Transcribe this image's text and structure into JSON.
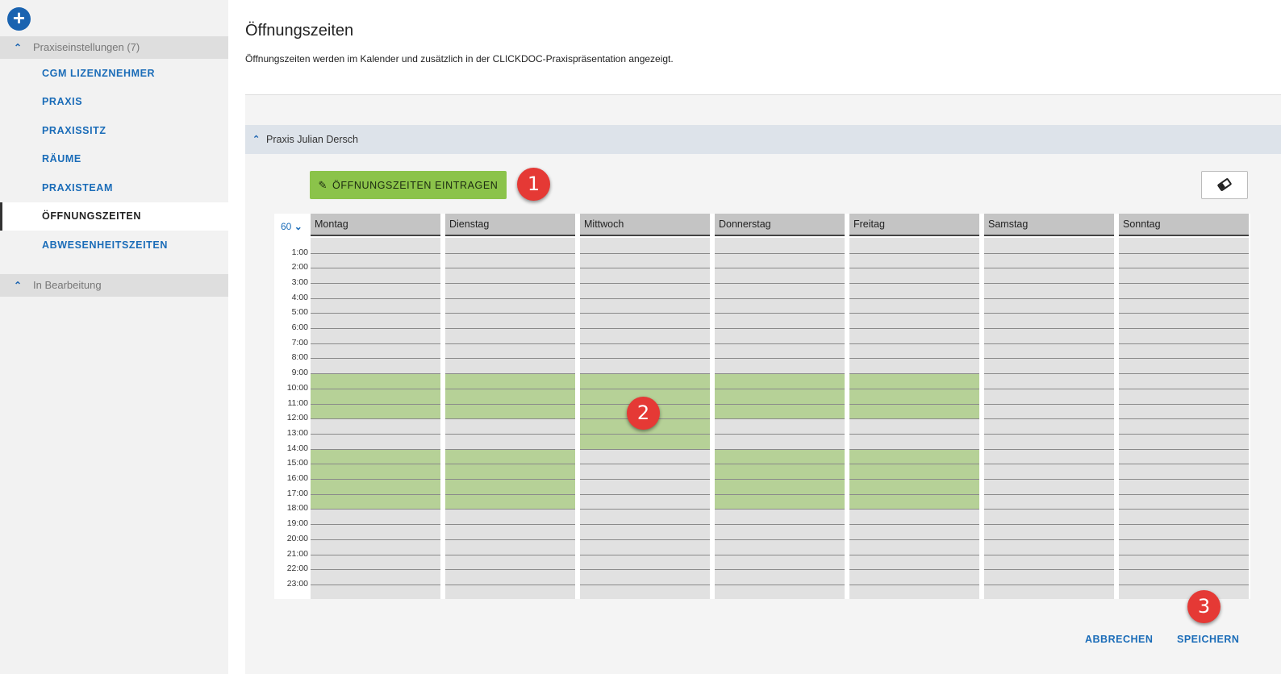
{
  "sidebar": {
    "add_icon": "plus-icon",
    "group_settings": "Praxiseinstellungen (7)",
    "items": [
      {
        "label": "CGM LIZENZNEHMER",
        "active": false
      },
      {
        "label": "PRAXIS",
        "active": false
      },
      {
        "label": "PRAXISSITZ",
        "active": false
      },
      {
        "label": "RÄUME",
        "active": false
      },
      {
        "label": "PRAXISTEAM",
        "active": false
      },
      {
        "label": "ÖFFNUNGSZEITEN",
        "active": true
      },
      {
        "label": "ABWESENHEITSZEITEN",
        "active": false
      }
    ],
    "group_editing": "In Bearbeitung"
  },
  "page": {
    "title": "Öffnungszeiten",
    "description": "Öffnungszeiten werden im Kalender und zusätzlich in der CLICKDOC-Praxispräsentation angezeigt."
  },
  "section": {
    "title": "Praxis Julian Dersch"
  },
  "toolbar": {
    "enter_label": "ÖFFNUNGSZEITEN EINTRAGEN",
    "enter_icon": "pencil-icon",
    "erase_icon": "eraser-icon"
  },
  "markers": [
    "1",
    "2",
    "3"
  ],
  "calendar": {
    "interval": "60",
    "days": [
      "Montag",
      "Dienstag",
      "Mittwoch",
      "Donnerstag",
      "Freitag",
      "Samstag",
      "Sonntag"
    ],
    "hours": [
      "1:00",
      "2:00",
      "3:00",
      "4:00",
      "5:00",
      "6:00",
      "7:00",
      "8:00",
      "9:00",
      "10:00",
      "11:00",
      "12:00",
      "13:00",
      "14:00",
      "15:00",
      "16:00",
      "17:00",
      "18:00",
      "19:00",
      "20:00",
      "21:00",
      "22:00",
      "23:00"
    ],
    "opening_hours": {
      "Montag": [
        [
          9,
          12
        ],
        [
          14,
          18
        ]
      ],
      "Dienstag": [
        [
          9,
          12
        ],
        [
          14,
          18
        ]
      ],
      "Mittwoch": [
        [
          9,
          14
        ]
      ],
      "Donnerstag": [
        [
          9,
          12
        ],
        [
          14,
          18
        ]
      ],
      "Freitag": [
        [
          9,
          12
        ],
        [
          14,
          18
        ]
      ],
      "Samstag": [],
      "Sonntag": []
    },
    "open_color": "#b6d197"
  },
  "actions": {
    "cancel_label": "ABBRECHEN",
    "save_label": "SPEICHERN"
  }
}
